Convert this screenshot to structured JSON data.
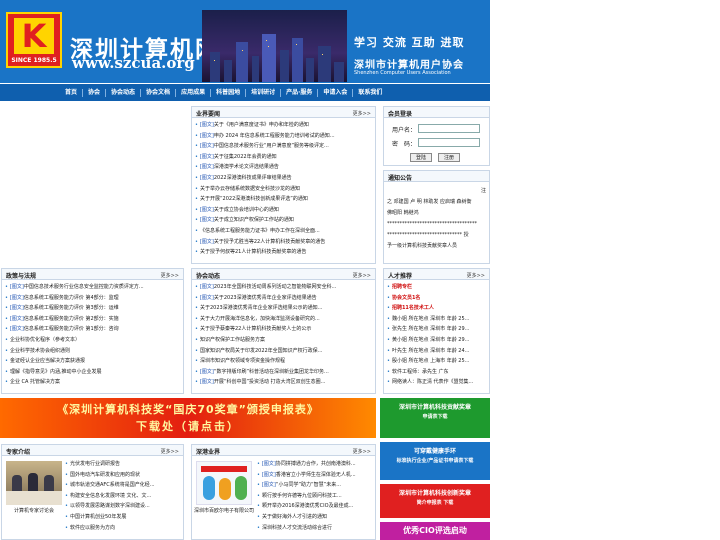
{
  "header": {
    "logo_letter": "K",
    "logo_since": "SINCE 1985.5",
    "site_name": "深圳计算机网",
    "site_url": "www.szcua.org",
    "slogan": "学习 交流 互助 进取",
    "assoc_cn": "深圳市计算机用户协会",
    "assoc_en": "Shenzhen Computer Users Association"
  },
  "nav": [
    "首页",
    "协会",
    "协会动态",
    "协会文档",
    "应用成果",
    "科普园地",
    "培训研讨",
    "产品·服务",
    "申请入会",
    "联系我们"
  ],
  "industry": {
    "title": "业界要闻",
    "more": "更多>>",
    "items": [
      {
        "tag": "[图文]",
        "text": "关于《用户满意度证书》申办和年检的通知"
      },
      {
        "tag": "[图文]",
        "text": "申办 2024 年信息系统工程服务能力培训考试的通知..."
      },
      {
        "tag": "[图文]",
        "text": "中国信息技术服务行业“用户满意度”服务等级评定..."
      },
      {
        "tag": "[图文]",
        "text": "关于征集2022年会费的通知"
      },
      {
        "tag": "[图文]",
        "text": "深港澳学术论文评选结果通告"
      },
      {
        "tag": "[图文]",
        "text": "2022深港澳科技成果评审结果通告"
      },
      {
        "tag": "",
        "text": "关于举办云存储系统数据安全科技沙龙的通知"
      },
      {
        "tag": "",
        "text": "关于开展“2022深港澳科技创新成果评选”的通知"
      },
      {
        "tag": "[图文]",
        "text": "关于成立协会培训中心的通知"
      },
      {
        "tag": "[图文]",
        "text": "关于成立知识产权保护工作站的通知"
      },
      {
        "tag": "",
        "text": "《信息系统工程服务能力证书》申办工作在深圳全面..."
      },
      {
        "tag": "[图文]",
        "text": "关于授予尤胜当等22人计算机科技贡献奖章的通告"
      },
      {
        "tag": "",
        "text": "关于授予何叔等21人计算机科技贡献奖章的通告"
      }
    ]
  },
  "login": {
    "title": "会员登录",
    "user_label": "用户名：",
    "pwd_label": "密　码：",
    "login_btn": "登陆",
    "reg_btn": "注册"
  },
  "notice": {
    "title": "通知公告",
    "lines": [
      "注",
      "之 邓建国 卢 明 林助发 应启瑞 森树衡",
      "佛昭阳 韩继鸿",
      "************************************",
      "****************************** 授",
      "予一级计算机科技贡献奖章人员"
    ]
  },
  "policy": {
    "title": "政策与法规",
    "more": "更多>>",
    "items": [
      {
        "tag": "[图文]",
        "text": "中国信息技术服务行业信息安全监控能力资质评定方..."
      },
      {
        "tag": "[图文]",
        "text": "信息系统工程服务能力评价 第4部分：监理"
      },
      {
        "tag": "[图文]",
        "text": "信息系统工程服务能力评价 第3部分：运维"
      },
      {
        "tag": "[图文]",
        "text": "信息系统工程服务能力评价 第2部分：实施"
      },
      {
        "tag": "[图文]",
        "text": "信息系统工程服务能力评价 第1部分：咨询"
      },
      {
        "tag": "",
        "text": "企业科协优化程序（参考文本）"
      },
      {
        "tag": "",
        "text": "企业科学技术协会组织通则"
      },
      {
        "tag": "",
        "text": "金证经认企业应当解决方案获通报"
      },
      {
        "tag": "",
        "text": "理解《指导意见》内涵,推动中小企业发展"
      },
      {
        "tag": "",
        "text": "企业 CA 托管解决方案"
      }
    ]
  },
  "activity": {
    "title": "协会动态",
    "more": "更多>>",
    "items": [
      {
        "tag": "[图文]",
        "text": "2023年全国科技活动周系列活动之智能物联网安全科..."
      },
      {
        "tag": "[图文]",
        "text": "关于2023深港澳优秀青年企业家评选结果通告"
      },
      {
        "tag": "",
        "text": "关于2023深港澳优秀青年企业家评选结果公示的通知..."
      },
      {
        "tag": "",
        "text": "关于大力开展海洋信息化，加快海洋监测设备研究的..."
      },
      {
        "tag": "",
        "text": "关于授予蔡秦等22人计算机科技贡献奖人士的公示"
      },
      {
        "tag": "",
        "text": "知识产权保护工作站服务方案"
      },
      {
        "tag": "",
        "text": "国家知识产权局关于印发2022年全国知识产权行政保..."
      },
      {
        "tag": "",
        "text": "深圳市知识产权领域专项资金操作规程"
      },
      {
        "tag": "[图文]",
        "text": "“数字排版印刷”科普活动在深圳新业集团龙华印务..."
      },
      {
        "tag": "[图文]",
        "text": "开展“科创中国”投资活动 打造大湾区双创生态圈..."
      }
    ]
  },
  "talent": {
    "title": "人才推荐",
    "more": "更多>>",
    "items": [
      {
        "text": "招聘专栏",
        "red": true
      },
      {
        "text": "协会文员1名",
        "red": true
      },
      {
        "text": "招聘11名技术工人",
        "red": true
      },
      {
        "text": "魏小姐 所在地点 深圳市 年龄 25...",
        "red": false
      },
      {
        "text": "张先生 所在地点 深圳市 年龄 29...",
        "red": false
      },
      {
        "text": "黄小姐 所在地点 深圳市 年龄 29...",
        "red": false
      },
      {
        "text": "叶先生 所在地点 深圳市 年龄 24...",
        "red": false
      },
      {
        "text": "殷小姐 所在地点 上海市 年龄 25...",
        "red": false
      },
      {
        "text": "软件工程师：承先生 广东",
        "red": false
      },
      {
        "text": "网络读人：陈正清 代表作《盟觉集...",
        "red": false
      }
    ]
  },
  "banner": {
    "line1": "《深圳计算机科技奖“国庆70奖章”颁授申报表》",
    "line2": "下载处（请点击）"
  },
  "side_ads": [
    {
      "a1": "深圳市计算机科技贡献奖章",
      "a2": "申请表下载",
      "color": "#1e9a2e"
    },
    {
      "a1": "可穿戴健康手环",
      "a2": "标准执行企业/产品证书申请表下载",
      "color": "#1a74c6"
    },
    {
      "a1": "深圳市计算机科技创新奖章",
      "a2": "简介申报表 下载",
      "color": "#e02020"
    },
    {
      "a1": "优秀CIO评选启动",
      "a2": "",
      "color": "#c020a0"
    }
  ],
  "experts": {
    "title": "专家介绍",
    "more": "更多>>",
    "caption": "计算机专家讨论会",
    "items": [
      "光伏发电行业调研报告",
      "国外电动汽车研发和应用的现状",
      "城市轨道交通AFC系统将是国产化经...",
      "构建安全信息化发展环境 文化、文...",
      "以领导发展思路谋划数字深圳建设...",
      "中国计算机创业50年发展",
      "软件应以服务为方向"
    ]
  },
  "business": {
    "title": "深港业界",
    "more": "更多>>",
    "caption": "深圳市百欧尔电子有限公司",
    "items": [
      {
        "tag": "[图文]",
        "text": "协同拼搏通力合作，共创南港澳科..."
      },
      {
        "tag": "[图文]",
        "text": "香港官立小学师生在深体验无人机..."
      },
      {
        "tag": "[图文]",
        "text": "“小马同学”助力“智慧”未来..."
      },
      {
        "tag": "",
        "text": "颗行按手何许德等九位顾问科技工..."
      },
      {
        "tag": "",
        "text": "颗开举办2016深港澳优秀CIO及最佳成..."
      },
      {
        "tag": "",
        "text": "关于做好海外人才引进的通知"
      },
      {
        "tag": "",
        "text": "深圳科技人才交流活动综合进行"
      }
    ]
  }
}
